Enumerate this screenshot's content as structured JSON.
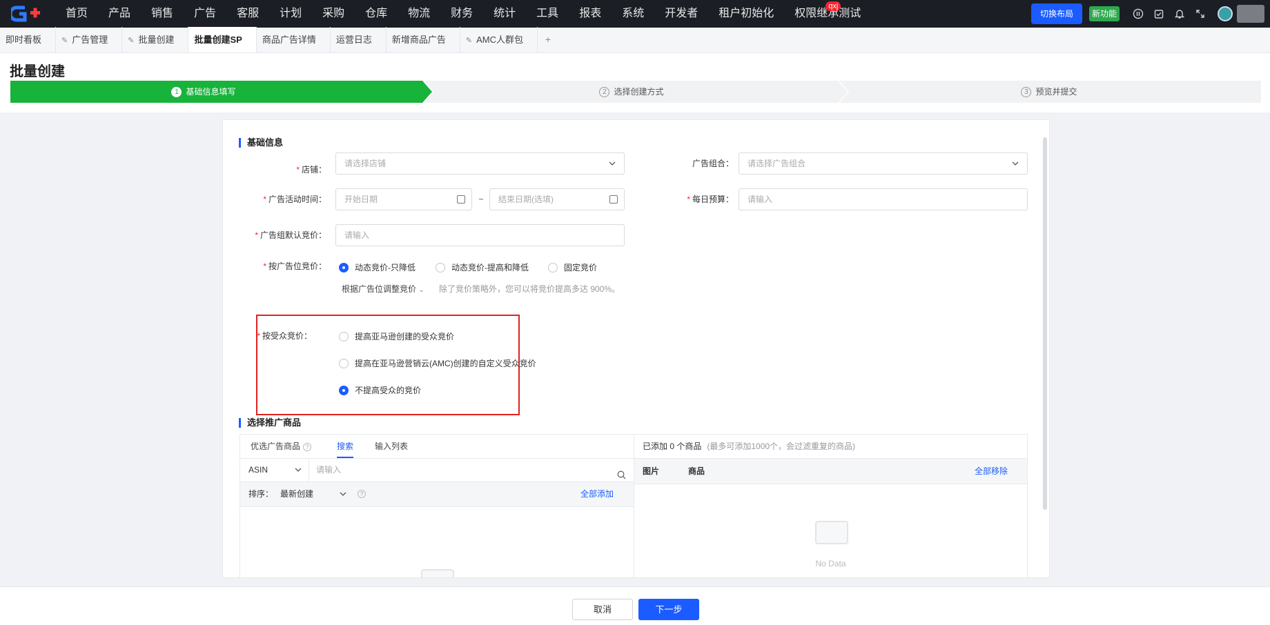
{
  "brand": {
    "logo_text": "G+"
  },
  "nav": {
    "items": [
      "首页",
      "产品",
      "销售",
      "广告",
      "客服",
      "计划",
      "采购",
      "仓库",
      "物流",
      "财务",
      "统计",
      "工具",
      "报表",
      "系统",
      "开发者",
      "租户初始化",
      "权限继承测试"
    ],
    "badge": "qxj",
    "switch_layout": "切换布局",
    "new_feature": "新功能"
  },
  "tabs": [
    {
      "label": "即时看板",
      "pinned": false,
      "active": false
    },
    {
      "label": "广告管理",
      "pinned": true,
      "active": false
    },
    {
      "label": "批量创建",
      "pinned": true,
      "active": false
    },
    {
      "label": "批量创建SP",
      "pinned": false,
      "active": true
    },
    {
      "label": "商品广告详情",
      "pinned": false,
      "active": false
    },
    {
      "label": "运营日志",
      "pinned": false,
      "active": false
    },
    {
      "label": "新增商品广告",
      "pinned": false,
      "active": false
    },
    {
      "label": "AMC人群包",
      "pinned": true,
      "active": false
    }
  ],
  "tab_add": "+",
  "page": {
    "title": "批量创建"
  },
  "steps": [
    {
      "num": "1",
      "label": "基础信息填写",
      "active": true
    },
    {
      "num": "2",
      "label": "选择创建方式",
      "active": false
    },
    {
      "num": "3",
      "label": "预览并提交",
      "active": false
    }
  ],
  "basic": {
    "section_title": "基础信息",
    "shop_label": "店铺：",
    "shop_placeholder": "请选择店铺",
    "portfolio_label": "广告组合：",
    "portfolio_placeholder": "请选择广告组合",
    "time_label": "广告活动时间：",
    "start_placeholder": "开始日期",
    "range_sep": "~",
    "end_placeholder": "结束日期(选填)",
    "budget_label": "每日预算：",
    "budget_placeholder": "请输入",
    "default_bid_label": "广告组默认竞价：",
    "default_bid_placeholder": "请输入",
    "placement_label": "按广告位竞价：",
    "placement_options": [
      "动态竞价-只降低",
      "动态竞价-提高和降低",
      "固定竞价"
    ],
    "placement_selected": 0,
    "adjust_label": "根据广告位调整竞价",
    "adjust_hint": "除了竞价策略外，您可以将竞价提高多达 900%。",
    "audience_label": "按受众竞价：",
    "audience_options": [
      "提高亚马逊创建的受众竞价",
      "提高在亚马逊营销云(AMC)创建的自定义受众竞价",
      "不提高受众的竞价"
    ],
    "audience_selected": 2
  },
  "products": {
    "section_title": "选择推广商品",
    "tabs": [
      "优选广告商品",
      "搜索",
      "输入列表"
    ],
    "active_tab": 1,
    "search_type": "ASIN",
    "search_placeholder": "请输入",
    "sort_label": "排序：",
    "sort_value": "最新创建",
    "add_all": "全部添加",
    "added_text": "已添加 0 个商品",
    "added_hint": "(最多可添加1000个，会过滤重复的商品)",
    "col_image": "图片",
    "col_product": "商品",
    "remove_all": "全部移除",
    "no_data": "No Data"
  },
  "footer": {
    "cancel": "取消",
    "next": "下一步"
  },
  "colors": {
    "accent": "#1a5cff",
    "step_active": "#18b33b",
    "required": "#f5222d",
    "highlight": "#e02020",
    "nav_bg": "#1b1e25"
  }
}
